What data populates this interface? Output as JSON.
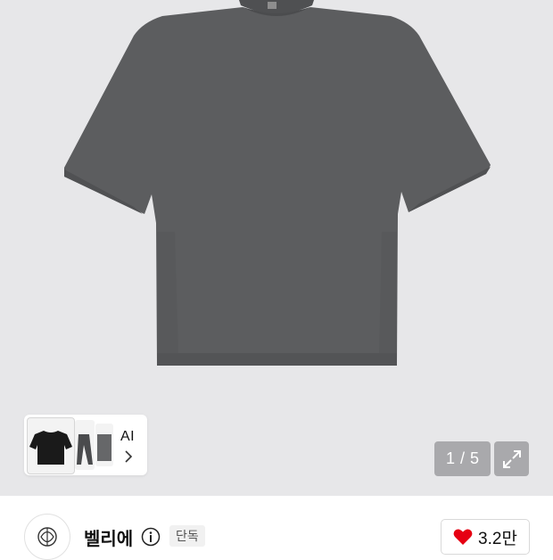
{
  "gallery": {
    "current_page": "1",
    "separator": "/",
    "total_pages": "5",
    "ai_label": "AI",
    "background_color": "#e7e7e9",
    "product_color": "#5b5c5e"
  },
  "brand": {
    "name": "벨리에",
    "badge": "단독",
    "logo_icon": "brand-logo-icon"
  },
  "like": {
    "count": "3.2만",
    "heart_color": "#e60012"
  },
  "icons": {
    "expand": "expand-arrows-icon",
    "info": "info-icon",
    "chevron": "chevron-right-icon",
    "heart": "heart-icon"
  }
}
